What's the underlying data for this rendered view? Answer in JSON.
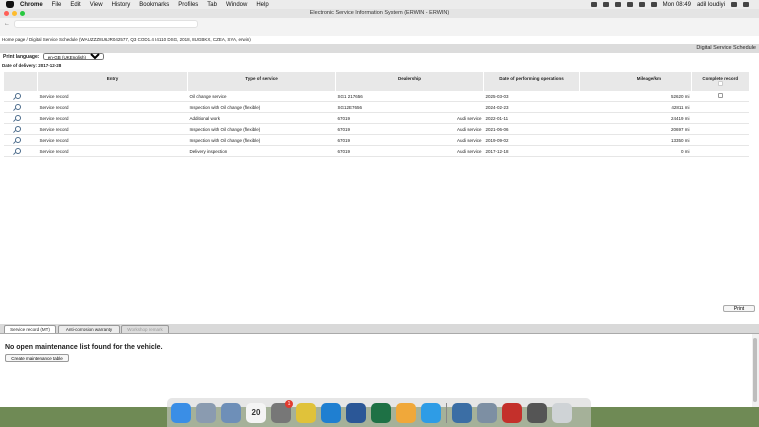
{
  "menubar": {
    "items": [
      "Chrome",
      "File",
      "Edit",
      "View",
      "History",
      "Bookmarks",
      "Profiles",
      "Tab",
      "Window",
      "Help"
    ],
    "clock": "Mon 08:49",
    "user": "adil loudiyi"
  },
  "window": {
    "title": "Electronic Service Information System (ERWIN - ERWIN)"
  },
  "breadcrumb": "Home page / Digital Service Schedule (WAUZZZ8U6JR042577, Q3 COD1.4 I4110 DSG, 2018, 8UGBKX, CZEA, SYA, erwin)",
  "header": {
    "title": "Digital Service Schedule"
  },
  "print_language": {
    "label": "Print language:",
    "value": "en-GB (UKEnglish)"
  },
  "delivery": {
    "label": "Date of delivery:",
    "value": "2017-12-28"
  },
  "table": {
    "headers": {
      "entry": "Entry",
      "type": "Type of service",
      "dealership": "Dealership",
      "date": "Date of performing operations",
      "mileage": "Mileage/km",
      "complete": "Complete record"
    },
    "rows": [
      {
        "entry": "Service record",
        "type": "Oil change service",
        "dealer_code": "SG1 217656",
        "dealer_name": "",
        "date": "2025-03-03",
        "mileage": "52620 mi",
        "has_checkbox": true
      },
      {
        "entry": "Service record",
        "type": "Inspection with Oil change (flexible)",
        "dealer_code": "SG12E7656",
        "dealer_name": "",
        "date": "2024-02-23",
        "mileage": "42811 mi",
        "has_checkbox": false
      },
      {
        "entry": "Service record",
        "type": "Additional work",
        "dealer_code": "67019",
        "dealer_name": "Audi service",
        "date": "2022-01-11",
        "mileage": "24419 mi",
        "has_checkbox": false
      },
      {
        "entry": "Service record",
        "type": "Inspection with Oil change (flexible)",
        "dealer_code": "67019",
        "dealer_name": "Audi service",
        "date": "2021-06-06",
        "mileage": "20697 mi",
        "has_checkbox": false
      },
      {
        "entry": "Service record",
        "type": "Inspection with Oil change (flexible)",
        "dealer_code": "67019",
        "dealer_name": "Audi service",
        "date": "2019-09-02",
        "mileage": "13350 mi",
        "has_checkbox": false
      },
      {
        "entry": "Service record",
        "type": "Delivery inspection",
        "dealer_code": "67019",
        "dealer_name": "Audi service",
        "date": "2017-12-18",
        "mileage": "0 mi",
        "has_checkbox": false
      }
    ]
  },
  "print_button": "Print",
  "tabs": [
    {
      "label": "Service record (MT)",
      "state": "active"
    },
    {
      "label": "Anti-corrosion warranty",
      "state": "normal"
    },
    {
      "label": "Workshop remark",
      "state": "disabled"
    }
  ],
  "maintenance": {
    "message": "No open maintenance list found for the vehicle.",
    "create_button": "Create maintenance table"
  },
  "dock": {
    "calendar_day": "20",
    "badge_count": "1"
  },
  "colors": {
    "header_bg": "#dcdcdc",
    "table_header_bg": "#e8e8e8",
    "link_icon": "#4a6a8a"
  }
}
